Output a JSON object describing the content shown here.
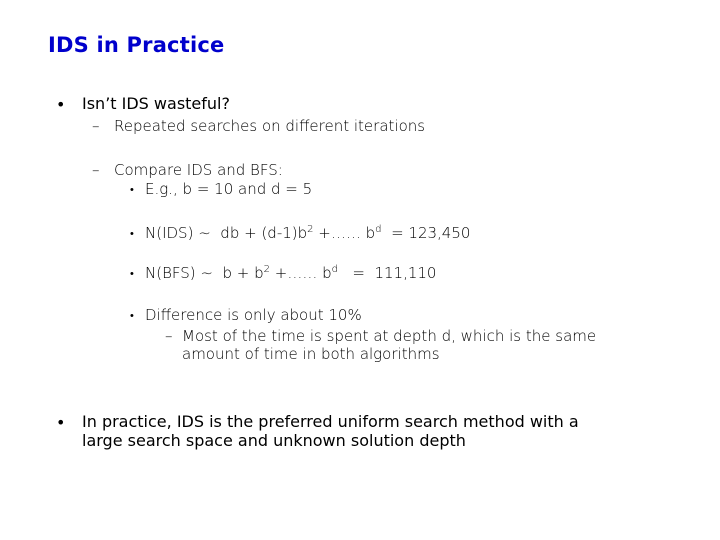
{
  "slide": {
    "title": "IDS in Practice",
    "bullets": [
      {
        "marker": "•",
        "text": "Isn’t IDS wasteful?",
        "children": [
          {
            "marker": "–",
            "text": "Repeated searches on different iterations"
          },
          {
            "marker": "–",
            "text": "Compare IDS and BFS:",
            "children": [
              {
                "marker": "•",
                "text": "E.g., b = 10 and d = 5"
              },
              {
                "marker": "•",
                "formula": {
                  "lhs": "N(IDS) ~  db + (d-1)b",
                  "exp1": "2",
                  "mid": " +…… b",
                  "exp2": "d",
                  "rhs": "  = 123,450"
                }
              },
              {
                "marker": "•",
                "formula": {
                  "lhs": "N(BFS) ~  b + b",
                  "exp1": "2",
                  "mid": " +…… b",
                  "exp2": "d",
                  "rhs": "   =  111,110"
                }
              },
              {
                "marker": "•",
                "text": "Difference is only about 10%",
                "children": [
                  {
                    "marker": "–",
                    "text_line1": "Most of the time is spent at depth d, which is the same",
                    "text_line2": "amount of time in both algorithms"
                  }
                ]
              }
            ]
          }
        ]
      },
      {
        "marker": "•",
        "text_line1": "In practice, IDS is the preferred uniform search method with a",
        "text_line2": "large search space and unknown solution depth"
      }
    ]
  }
}
